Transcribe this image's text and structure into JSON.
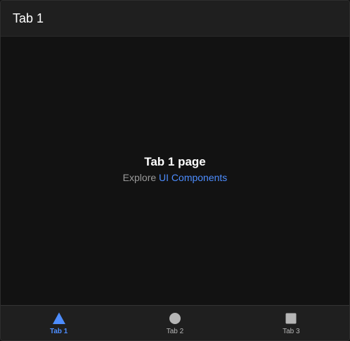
{
  "header": {
    "title": "Tab 1"
  },
  "content": {
    "page_title": "Tab 1 page",
    "explore_prefix": "Explore",
    "explore_link": "UI Components"
  },
  "tabs": [
    {
      "label": "Tab 1",
      "icon": "triangle-icon",
      "active": true
    },
    {
      "label": "Tab 2",
      "icon": "ellipse-icon",
      "active": false
    },
    {
      "label": "Tab 3",
      "icon": "square-icon",
      "active": false
    }
  ],
  "colors": {
    "accent": "#4d8dff",
    "inactive_icon": "#b5b5b5",
    "background": "#121212",
    "bar_background": "#1f1f1f"
  }
}
